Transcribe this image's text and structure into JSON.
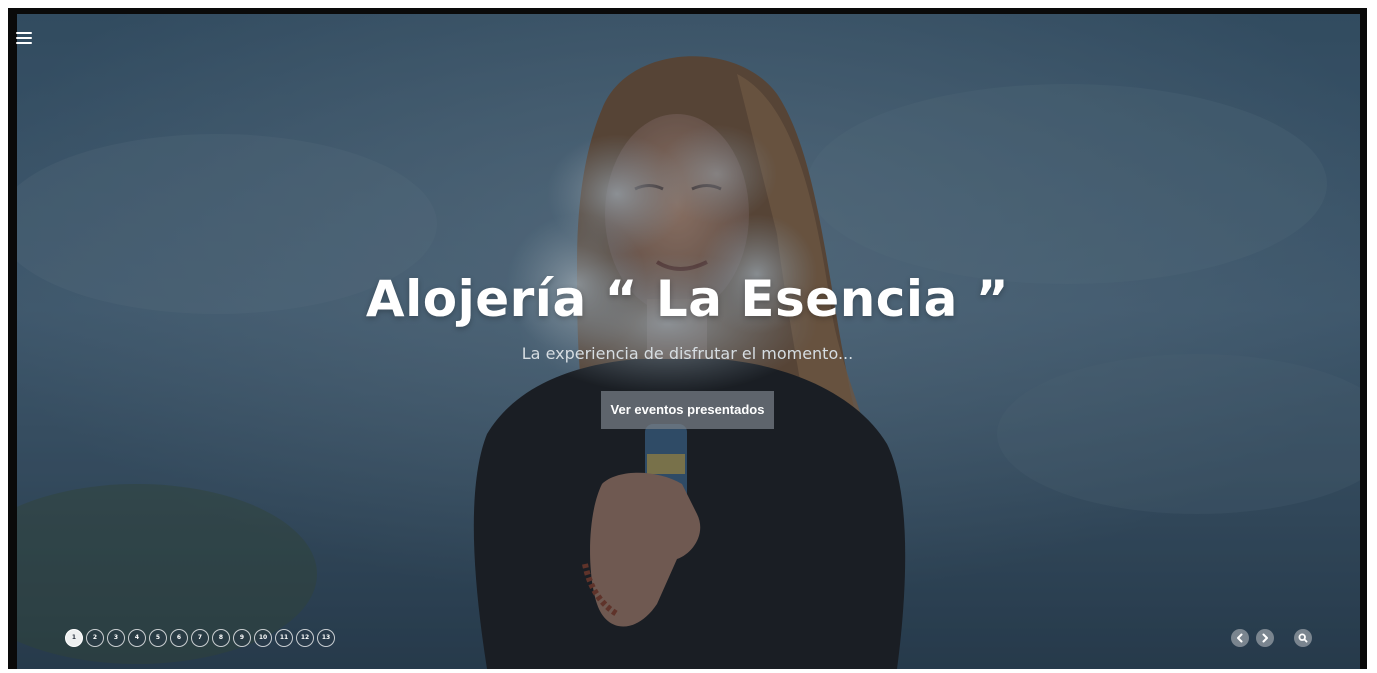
{
  "hero": {
    "title": "Alojería “ La Esencia ”",
    "subtitle": "La experiencia de disfrutar el momento...",
    "cta_label": "Ver eventos presentados"
  },
  "menu": {
    "icon": "hamburger-menu-icon"
  },
  "pager": {
    "active_index": 0,
    "pages": [
      "1",
      "2",
      "3",
      "4",
      "5",
      "6",
      "7",
      "8",
      "9",
      "10",
      "11",
      "12",
      "13"
    ]
  },
  "controls": {
    "prev_icon": "chevron-left-icon",
    "next_icon": "chevron-right-icon",
    "zoom_icon": "magnifier-icon"
  },
  "colors": {
    "frame": "#0a0a0a",
    "sky": "#4a6478",
    "sweater": "#1e1e20",
    "hair": "#7a5a40",
    "text": "#ffffff"
  }
}
